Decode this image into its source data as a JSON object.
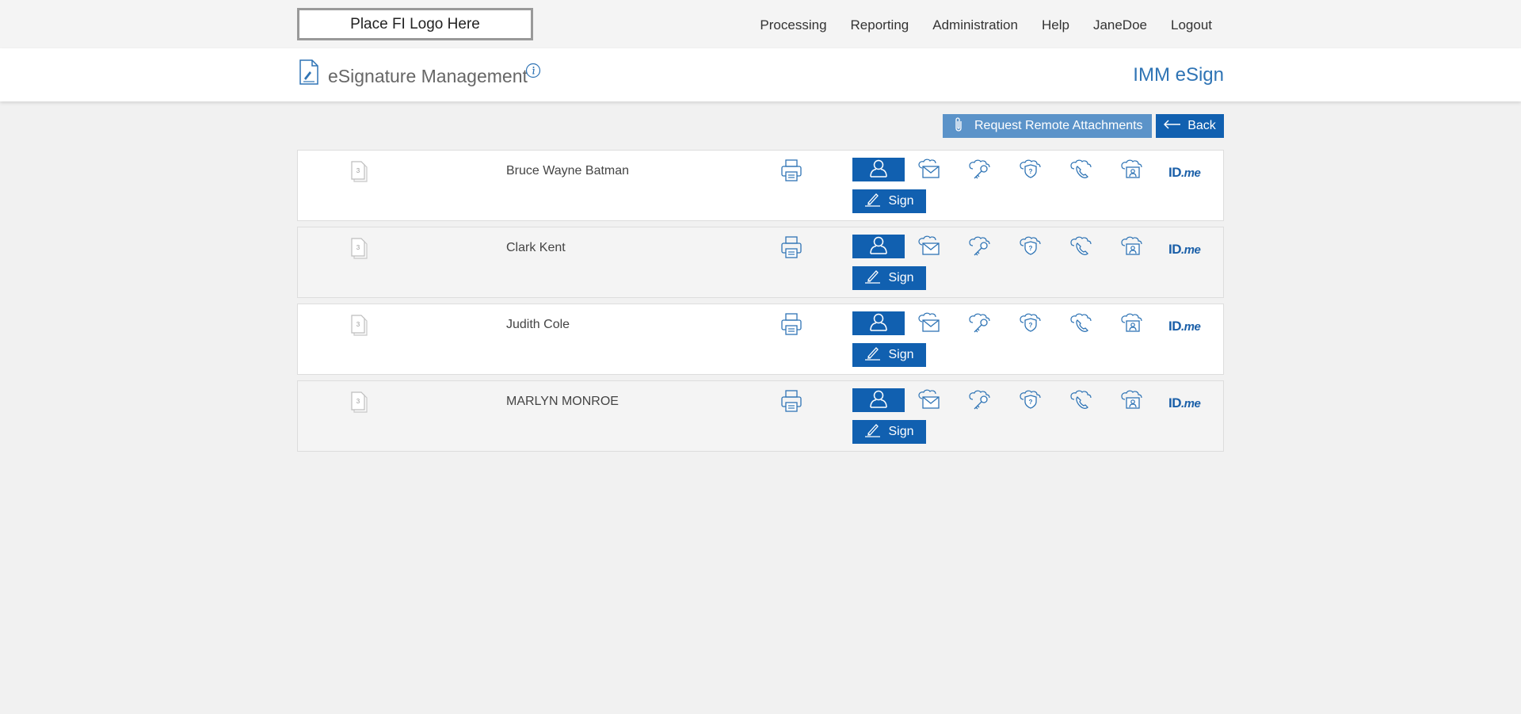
{
  "header": {
    "logo_placeholder": "Place FI Logo Here",
    "nav": [
      "Processing",
      "Reporting",
      "Administration",
      "Help",
      "JaneDoe",
      "Logout"
    ]
  },
  "titlebar": {
    "title": "eSignature Management",
    "app_name": "IMM eSign"
  },
  "toolbar": {
    "attach_label": "Request Remote Attachments",
    "back_label": "Back"
  },
  "signers": [
    {
      "name": "Bruce Wayne Batman",
      "doc_count": "3",
      "sign_label": "Sign",
      "idme_id": "ID",
      "idme_me": ".me"
    },
    {
      "name": "Clark Kent",
      "doc_count": "3",
      "sign_label": "Sign",
      "idme_id": "ID",
      "idme_me": ".me"
    },
    {
      "name": "Judith Cole",
      "doc_count": "3",
      "sign_label": "Sign",
      "idme_id": "ID",
      "idme_me": ".me"
    },
    {
      "name": "MARLYN MONROE",
      "doc_count": "3",
      "sign_label": "Sign",
      "idme_id": "ID",
      "idme_me": ".me"
    }
  ],
  "icons": {
    "auth_methods": [
      "in-person-icon",
      "email-icon",
      "key-icon",
      "security-question-icon",
      "phone-icon",
      "id-verification-icon",
      "idme-logo"
    ]
  },
  "colors": {
    "primary": "#1160b0",
    "secondary": "#5b93c9",
    "app_name": "#2f74b5"
  }
}
